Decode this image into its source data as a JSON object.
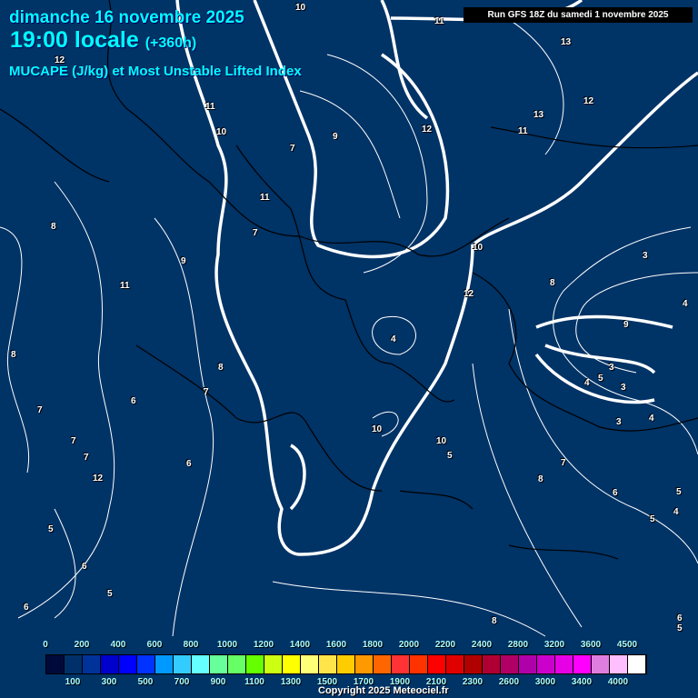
{
  "header": {
    "date": "dimanche 16 novembre 2025",
    "time": "19:00 locale",
    "offset": "(+360h)",
    "title": "MUCAPE (J/kg) et Most Unstable Lifted Index",
    "run": "Run GFS 18Z du samedi 1 novembre 2025"
  },
  "contour_labels": [
    "10",
    "11",
    "13",
    "12",
    "12",
    "13",
    "11",
    "11",
    "10",
    "7",
    "9",
    "12",
    "11",
    "7",
    "8",
    "9",
    "11",
    "10",
    "8",
    "12",
    "4",
    "3",
    "4",
    "9",
    "8",
    "8",
    "7",
    "6",
    "7",
    "7",
    "7",
    "12",
    "10",
    "10",
    "5",
    "3",
    "4",
    "5",
    "3",
    "4",
    "3",
    "6",
    "8",
    "7",
    "6",
    "5",
    "5",
    "4",
    "5",
    "6",
    "5",
    "8",
    "6",
    "6",
    "5"
  ],
  "legend": {
    "colors": [
      "#000a3a",
      "#00306a",
      "#00339a",
      "#0000cc",
      "#0000ff",
      "#0033ff",
      "#0099ff",
      "#33ccff",
      "#66ffff",
      "#66ff99",
      "#66ff66",
      "#66ff00",
      "#ccff11",
      "#ffff00",
      "#ffff77",
      "#ffe54a",
      "#ffcc00",
      "#ff9900",
      "#ff6600",
      "#ff3333",
      "#ff3300",
      "#ff0000",
      "#e00000",
      "#b00000",
      "#b00033",
      "#b00066",
      "#b000aa",
      "#cc00cc",
      "#e600e6",
      "#ff00ff",
      "#e07ee0",
      "#ffbfff",
      "#ffffff"
    ],
    "top": [
      "0",
      "200",
      "400",
      "600",
      "800",
      "1000",
      "1200",
      "1400",
      "1600",
      "1800",
      "2000",
      "2200",
      "2400",
      "2800",
      "3200",
      "3600",
      "4500"
    ],
    "bottom": [
      "100",
      "300",
      "500",
      "700",
      "900",
      "1100",
      "1300",
      "1500",
      "1700",
      "1900",
      "2100",
      "2300",
      "2600",
      "3000",
      "3400",
      "4000"
    ]
  },
  "copyright": "Copyright 2025 Meteociel.fr"
}
